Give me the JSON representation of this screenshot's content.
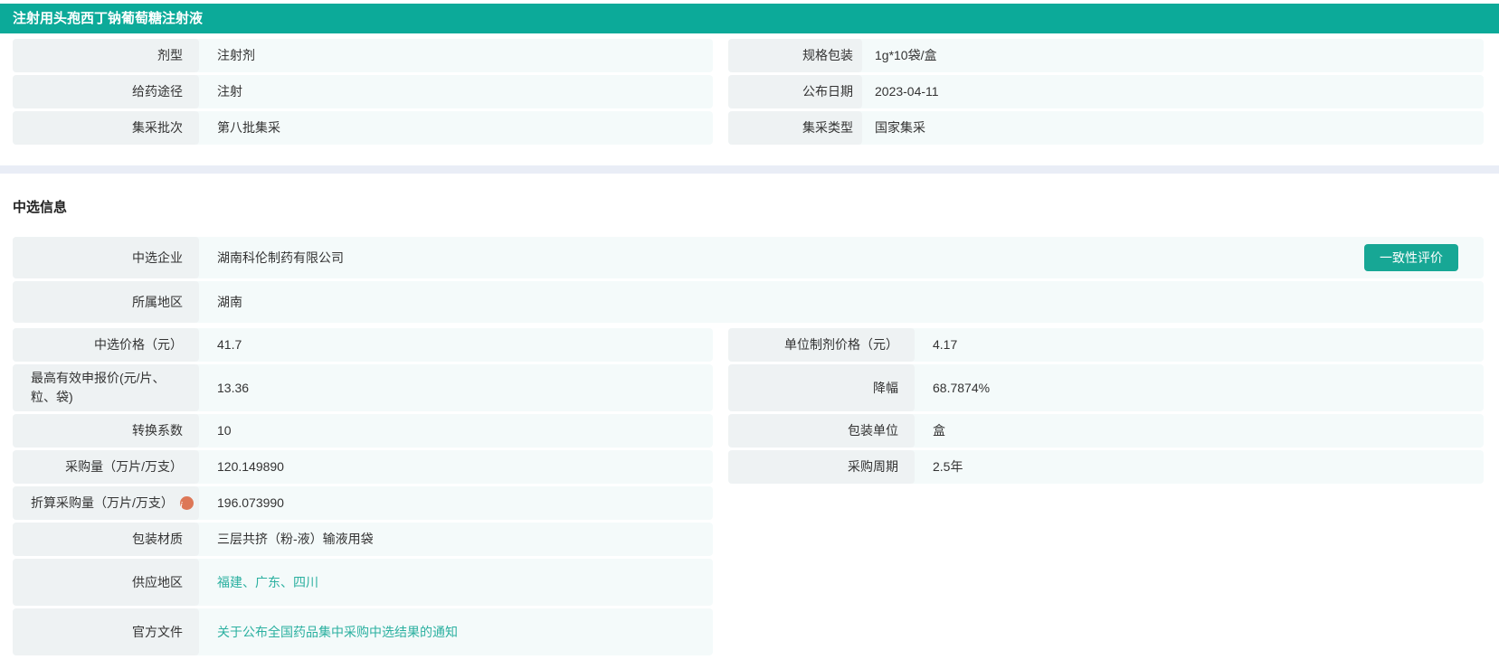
{
  "colors": {
    "header_teal": "#0caa99",
    "button_teal": "#17a795",
    "link_teal": "#2bb0a0",
    "label_bg": "#eef2f3",
    "value_bg": "#f4fafa",
    "divider_bg": "#e9edf6",
    "info_icon_orange": "#dd7757"
  },
  "header": {
    "title": "注射用头孢西丁钠葡萄糖注射液"
  },
  "basic_info": {
    "left": [
      {
        "label": "剂型",
        "value": "注射剂"
      },
      {
        "label": "给药途径",
        "value": "注射"
      },
      {
        "label": "集采批次",
        "value": "第八批集采"
      }
    ],
    "right": [
      {
        "label": "规格包装",
        "value": "1g*10袋/盒"
      },
      {
        "label": "公布日期",
        "value": "2023-04-11"
      },
      {
        "label": "集采类型",
        "value": "国家集采"
      }
    ]
  },
  "selection": {
    "heading": "中选信息",
    "enterprise": {
      "label": "中选企业",
      "value": "湖南科伦制药有限公司",
      "button_label": "一致性评价"
    },
    "region": {
      "label": "所属地区",
      "value": "湖南"
    },
    "paired_rows": [
      {
        "left": {
          "label": "中选价格（元）",
          "value": "41.7"
        },
        "right": {
          "label": "单位制剂价格（元）",
          "value": "4.17"
        }
      },
      {
        "left": {
          "label": "最高有效申报价(元/片、粒、袋)",
          "value": "13.36"
        },
        "right": {
          "label": "降幅",
          "value": "68.7874%"
        }
      },
      {
        "left": {
          "label": "转换系数",
          "value": "10"
        },
        "right": {
          "label": "包装单位",
          "value": "盒"
        }
      },
      {
        "left": {
          "label": "采购量（万片/万支）",
          "value": "120.149890"
        },
        "right": {
          "label": "采购周期",
          "value": "2.5年"
        }
      }
    ],
    "detail_rows": [
      {
        "label": "折算采购量（万片/万支）",
        "value": "196.073990"
      },
      {
        "label": "包装材质",
        "value": "三层共挤（粉-液）输液用袋"
      },
      {
        "label": "供应地区",
        "value": "福建、广东、四川"
      },
      {
        "label": "官方文件",
        "value": "关于公布全国药品集中采购中选结果的通知"
      }
    ]
  }
}
